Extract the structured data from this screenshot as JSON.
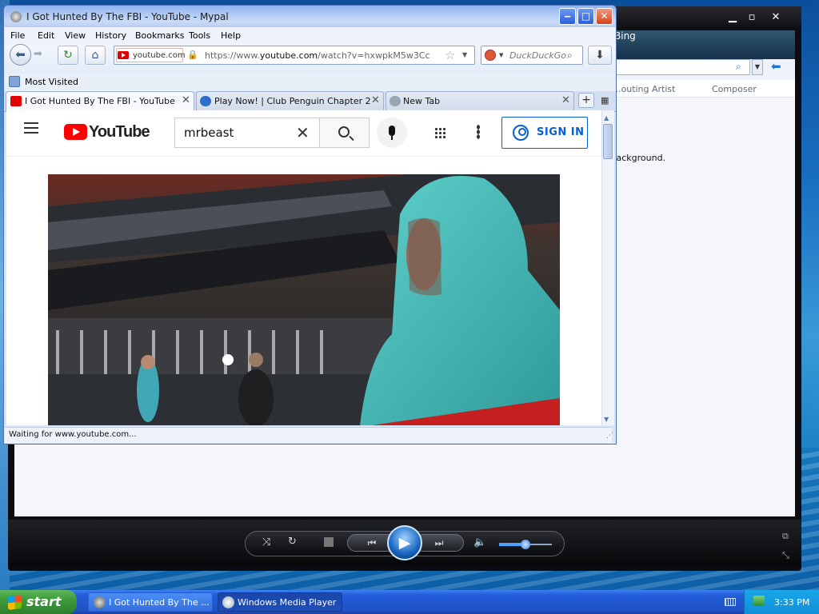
{
  "colors": {
    "youtube_red": "#ff0000",
    "youtube_blue": "#065fd4",
    "xp_taskbar": "#245edb",
    "xp_start_green": "#3c9b3a"
  },
  "wmp": {
    "nav_label": "Bing",
    "columns": [
      "Contributing Artist",
      "Composer"
    ],
    "visible_columns": [
      "...outing Artist",
      "Composer"
    ],
    "message_fragment": "...ackground.",
    "controls": [
      "shuffle-icon",
      "repeat-icon",
      "stop-icon",
      "previous-icon",
      "play-icon",
      "next-icon",
      "volume-icon"
    ],
    "volume_level": 0.5
  },
  "browser": {
    "window_title": "I Got Hunted By The FBI - YouTube - Mypal",
    "menu": [
      "File",
      "Edit",
      "View",
      "History",
      "Bookmarks",
      "Tools",
      "Help"
    ],
    "identity_label": "youtube.com",
    "url_prefix": "https://www.",
    "url_domain": "youtube.com",
    "url_path": "/watch?v=hxwpkM5w3Cc",
    "search_engine": "DuckDuckGo",
    "bookmarks_label": "Most Visited",
    "tabs": [
      {
        "label": "I Got Hunted By The FBI - YouTube",
        "active": true,
        "icon": "youtube-icon"
      },
      {
        "label": "Play Now! | Club Penguin Chapter 2",
        "active": false,
        "icon": "penguin-icon"
      },
      {
        "label": "New Tab",
        "active": false,
        "icon": "globe-icon"
      }
    ],
    "status": "Waiting for www.youtube.com..."
  },
  "youtube": {
    "logo_text": "YouTube",
    "search_value": "mrbeast",
    "signin_label": "SIGN IN"
  },
  "taskbar": {
    "start_label": "start",
    "tasks": [
      {
        "label": "I Got Hunted By The ...",
        "icon": "mypal-icon",
        "active": false
      },
      {
        "label": "Windows Media Player",
        "icon": "wmp-icon",
        "active": true
      }
    ],
    "clock": "3:33 PM"
  }
}
